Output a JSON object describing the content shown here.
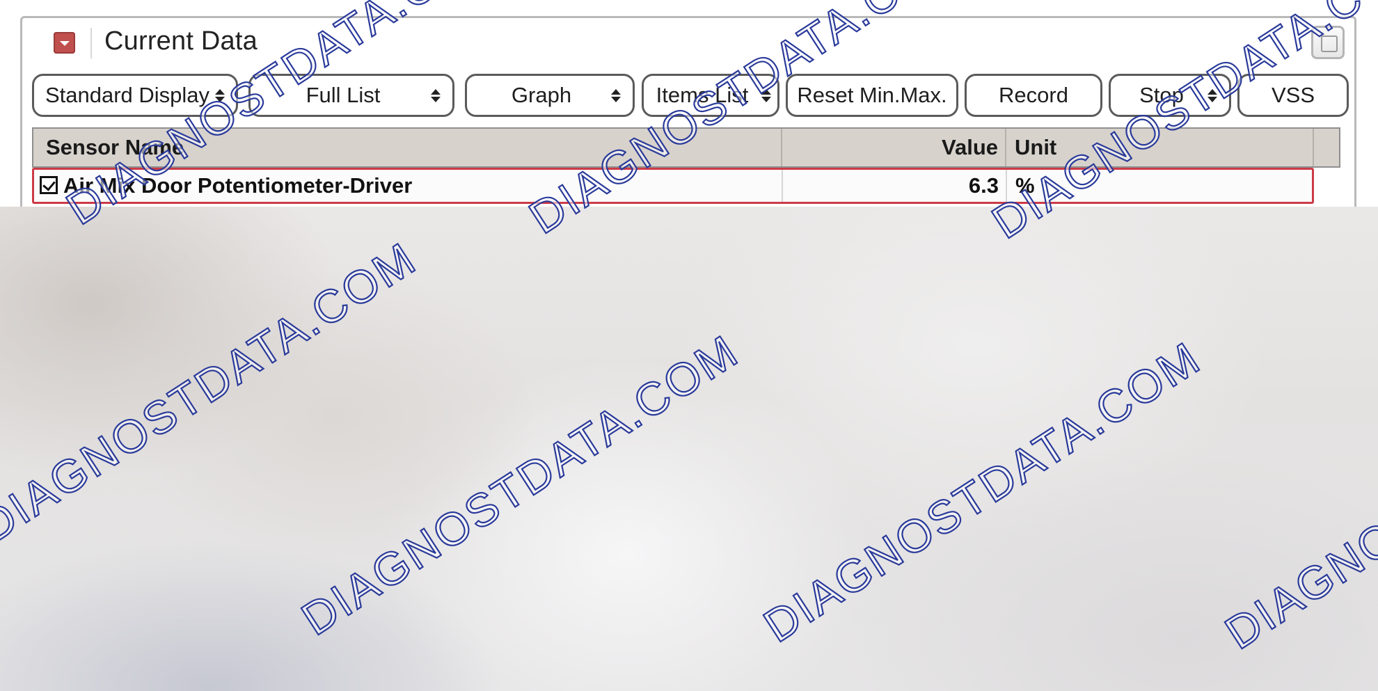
{
  "panel": {
    "title": "Current Data"
  },
  "toolbar": {
    "standard_display": "Standard Display",
    "full_list": "Full List",
    "graph": "Graph",
    "items_list": "Items List",
    "reset_min_max": "Reset Min.Max.",
    "record": "Record",
    "stop": "Stop",
    "vss": "VSS"
  },
  "table": {
    "headers": {
      "sensor_name": "Sensor Name",
      "value": "Value",
      "unit": "Unit"
    },
    "rows": [
      {
        "sensor": "Air Mix Door Potentiometer-Driver",
        "value": "6.3",
        "unit": "%",
        "checked": true
      }
    ]
  },
  "watermark": {
    "text": "DIAGNOSTDATA.COM",
    "color": "#2a3a9a"
  },
  "colors": {
    "collapse_icon": "#c0504d",
    "selected_row_border": "#cc3b47",
    "header_bg": "#d7d2cc"
  }
}
